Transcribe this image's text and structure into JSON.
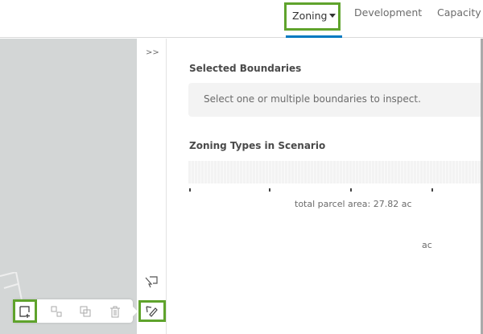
{
  "tabs": [
    {
      "label": "Zoning"
    },
    {
      "label": "Development"
    },
    {
      "label": "Capacity"
    }
  ],
  "sidebar": {
    "expand_label": ">>"
  },
  "panel": {
    "selected_boundaries_title": "Selected Boundaries",
    "inspect_hint": "Select one or multiple boundaries to inspect.",
    "zoning_types_title": "Zoning Types in Scenario",
    "total_area": "total parcel area: 27.82 ac",
    "unit": "ac"
  },
  "colors": {
    "highlight": "#5fa32c",
    "tab_underline": "#0079c1",
    "map": "#d3d6d6"
  }
}
